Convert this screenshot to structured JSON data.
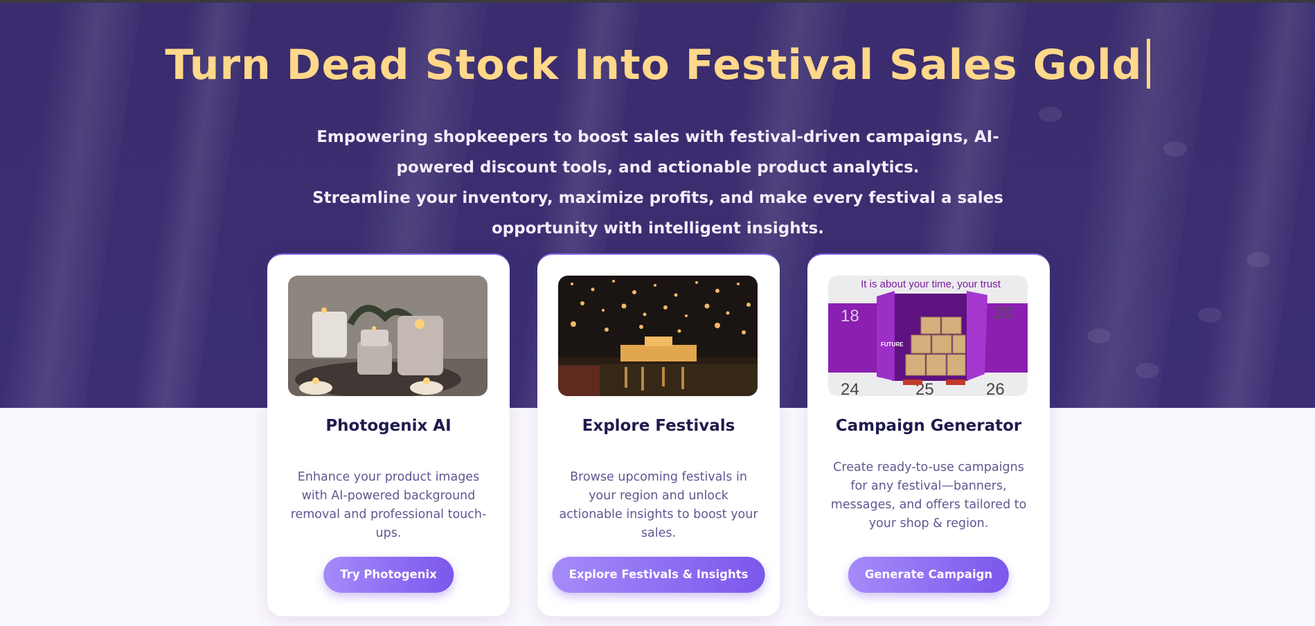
{
  "hero": {
    "title": "Turn Dead Stock Into Festival Sales Gold",
    "subtitle_lines": [
      "Empowering shopkeepers to boost sales with festival-driven campaigns, AI-powered discount tools, and actionable product analytics.",
      "Streamline your inventory, maximize profits, and make every festival a sales opportunity with intelligent insights."
    ]
  },
  "cards": [
    {
      "title": "Photogenix AI",
      "description": "Enhance your product images with AI-powered background removal and professional touch-ups.",
      "button": "Try Photogenix",
      "image": "candles-photo"
    },
    {
      "title": "Explore Festivals",
      "description": "Browse upcoming festivals in your region and unlock actionable insights to boost your sales.",
      "button": "Explore Festivals & Insights",
      "image": "lanterns-festival-photo"
    },
    {
      "title": "Campaign Generator",
      "description": "Create ready-to-use campaigns for any festival—banners, messages, and offers tailored to your shop & region.",
      "button": "Generate Campaign",
      "image": "calendar-box-ad",
      "image_text": {
        "tagline": "It is about your time, your trust",
        "brand": "FUTURE",
        "numbers": [
          "18",
          "20",
          "24",
          "25",
          "26"
        ]
      }
    }
  ],
  "colors": {
    "hero_bg": "#3a2c6e",
    "title": "#ffd88a",
    "accent": "#8d6cf0",
    "card_title": "#1f1b4d",
    "card_text": "#5f5891"
  }
}
